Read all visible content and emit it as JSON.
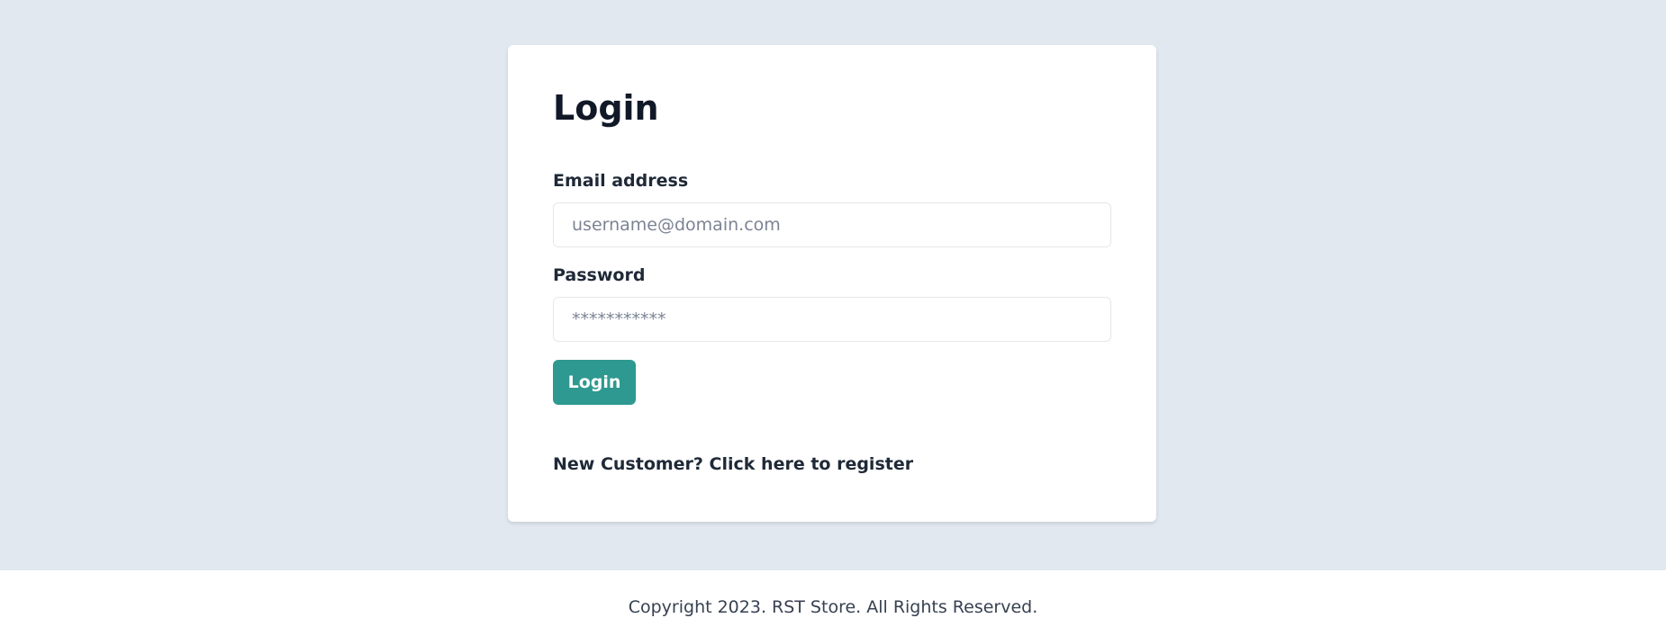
{
  "login": {
    "title": "Login",
    "email_label": "Email address",
    "email_placeholder": "username@domain.com",
    "email_value": "",
    "password_label": "Password",
    "password_placeholder": "***********",
    "password_value": "",
    "submit_label": "Login",
    "register_link": "New Customer? Click here to register"
  },
  "footer": {
    "copyright": "Copyright 2023. RST Store. All Rights Reserved."
  },
  "colors": {
    "page_background": "#e2e8f0",
    "card_background": "#ffffff",
    "button_background": "#2e9990",
    "button_text": "#ffffff",
    "text": "#111827"
  }
}
